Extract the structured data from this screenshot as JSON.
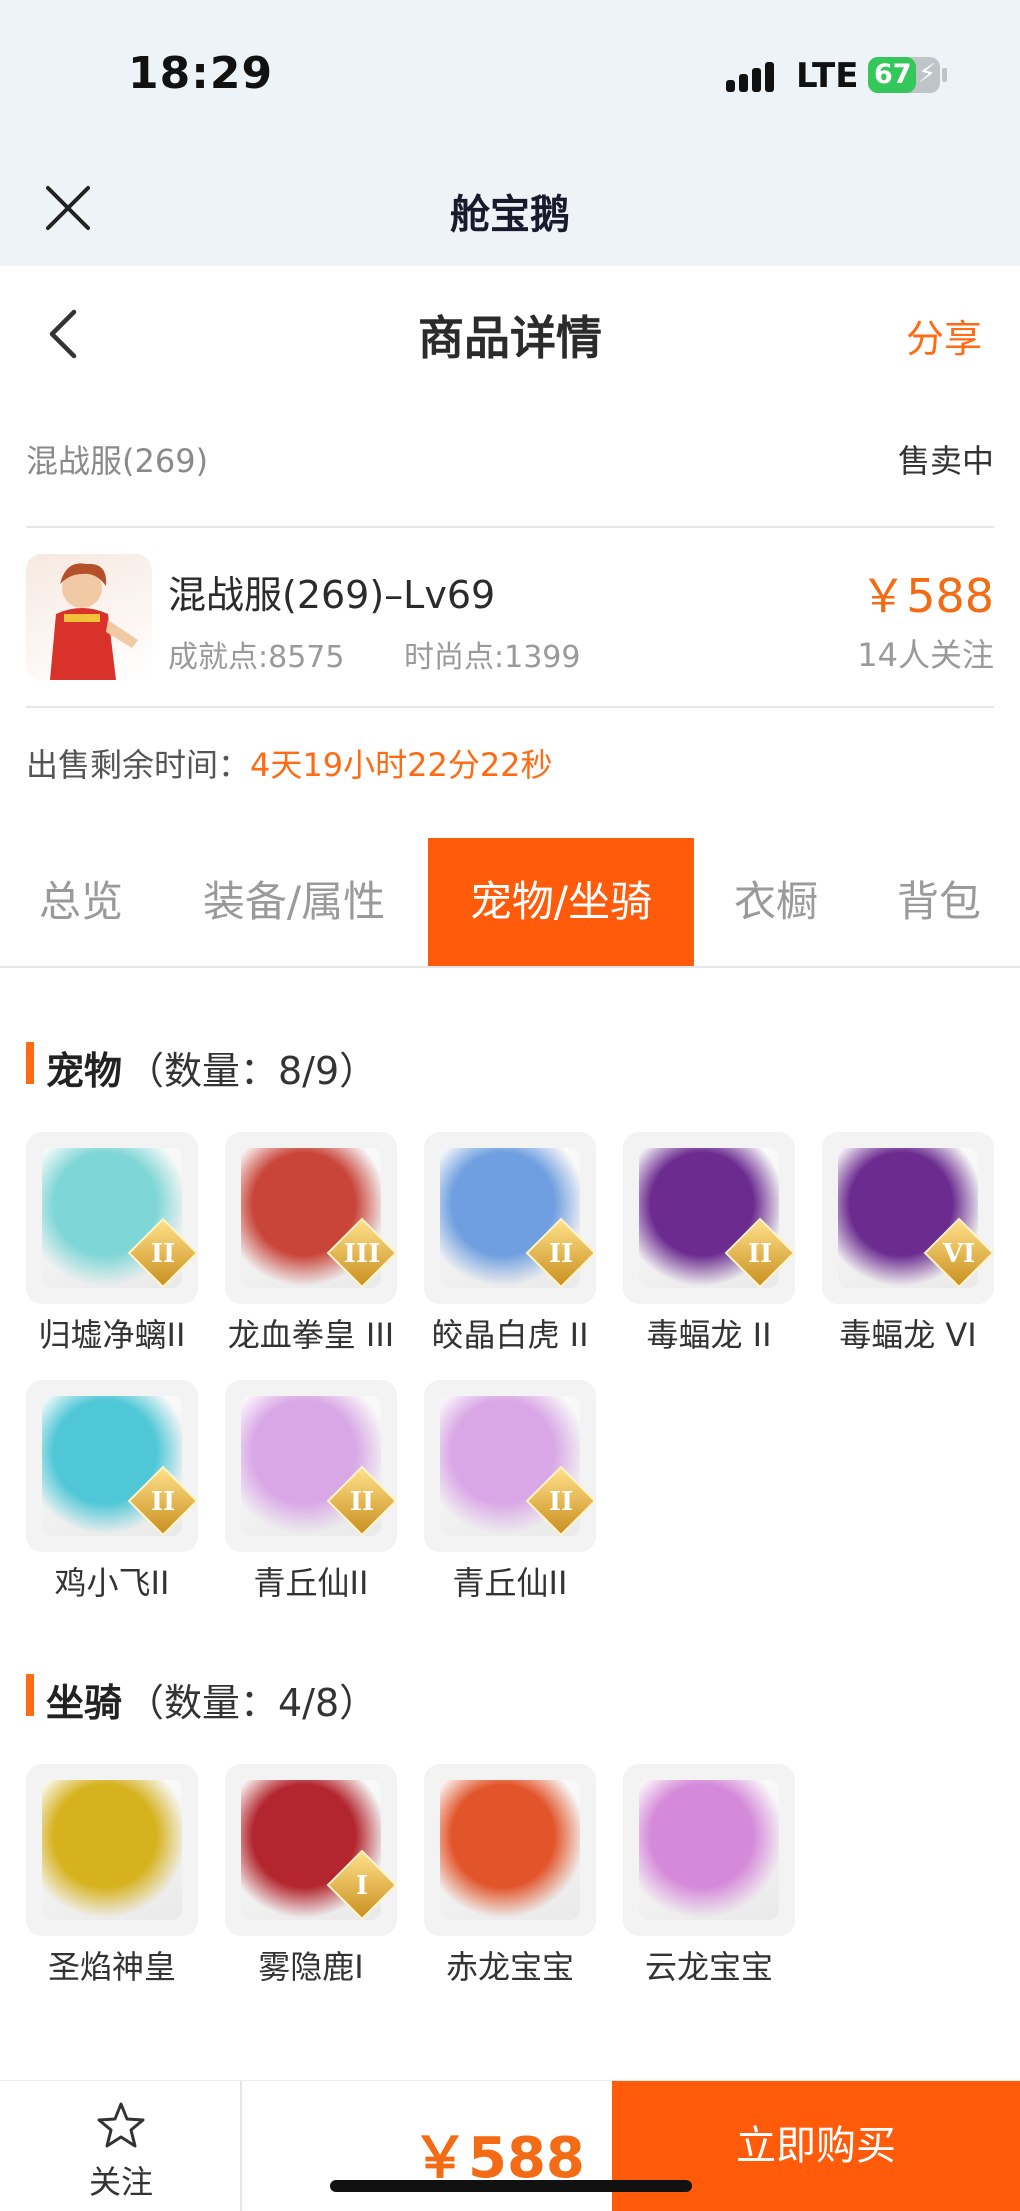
{
  "status_bar": {
    "time": "18:29",
    "network": "LTE",
    "battery": "67",
    "battery_level": 0.67
  },
  "app_bar": {
    "title": "舱宝鹅"
  },
  "nav": {
    "title": "商品详情",
    "share": "分享"
  },
  "listing": {
    "server": "混战服(269)",
    "status": "售卖中",
    "name": "混战服(269)–Lv69",
    "achievement": "成就点:8575",
    "fashion": "时尚点:1399",
    "price": "￥588",
    "followers": "14人关注",
    "remaining_label": "出售剩余时间：",
    "remaining_value": "4天19小时22分22秒"
  },
  "tabs": [
    {
      "label": "总览",
      "active": false
    },
    {
      "label": "装备/属性",
      "active": false
    },
    {
      "label": "宠物/坐骑",
      "active": true
    },
    {
      "label": "衣橱",
      "active": false
    },
    {
      "label": "背包",
      "active": false
    }
  ],
  "pets": {
    "title": "宠物",
    "count": "（数量：8/9）",
    "items": [
      {
        "name": "归墟净螭II",
        "badge": "II",
        "color": "#7fd6d6"
      },
      {
        "name": "龙血拳皇 III",
        "badge": "III",
        "color": "#c9453a"
      },
      {
        "name": "皎晶白虎 II",
        "badge": "II",
        "color": "#6f9fe0"
      },
      {
        "name": "毒蝠龙 II",
        "badge": "II",
        "color": "#6b2b8f"
      },
      {
        "name": "毒蝠龙 VI",
        "badge": "VI",
        "color": "#6b2b8f"
      },
      {
        "name": "鸡小飞II",
        "badge": "II",
        "color": "#4fc7d6"
      },
      {
        "name": "青丘仙II",
        "badge": "II",
        "color": "#d9a7e6"
      },
      {
        "name": "青丘仙II",
        "badge": "II",
        "color": "#d9a7e6"
      }
    ]
  },
  "mounts": {
    "title": "坐骑",
    "count": "（数量：4/8）",
    "items": [
      {
        "name": "圣焰神皇",
        "badge": "",
        "color": "#d6b21f"
      },
      {
        "name": "雾隐鹿I",
        "badge": "I",
        "color": "#b3262e"
      },
      {
        "name": "赤龙宝宝",
        "badge": "",
        "color": "#e2552b"
      },
      {
        "name": "云龙宝宝",
        "badge": "",
        "color": "#d58ad9"
      }
    ]
  },
  "bottom": {
    "favorite": "关注",
    "price": "￥588",
    "buy": "立即购买"
  },
  "colors": {
    "accent": "#ff5b0a",
    "price": "#f36b14"
  }
}
